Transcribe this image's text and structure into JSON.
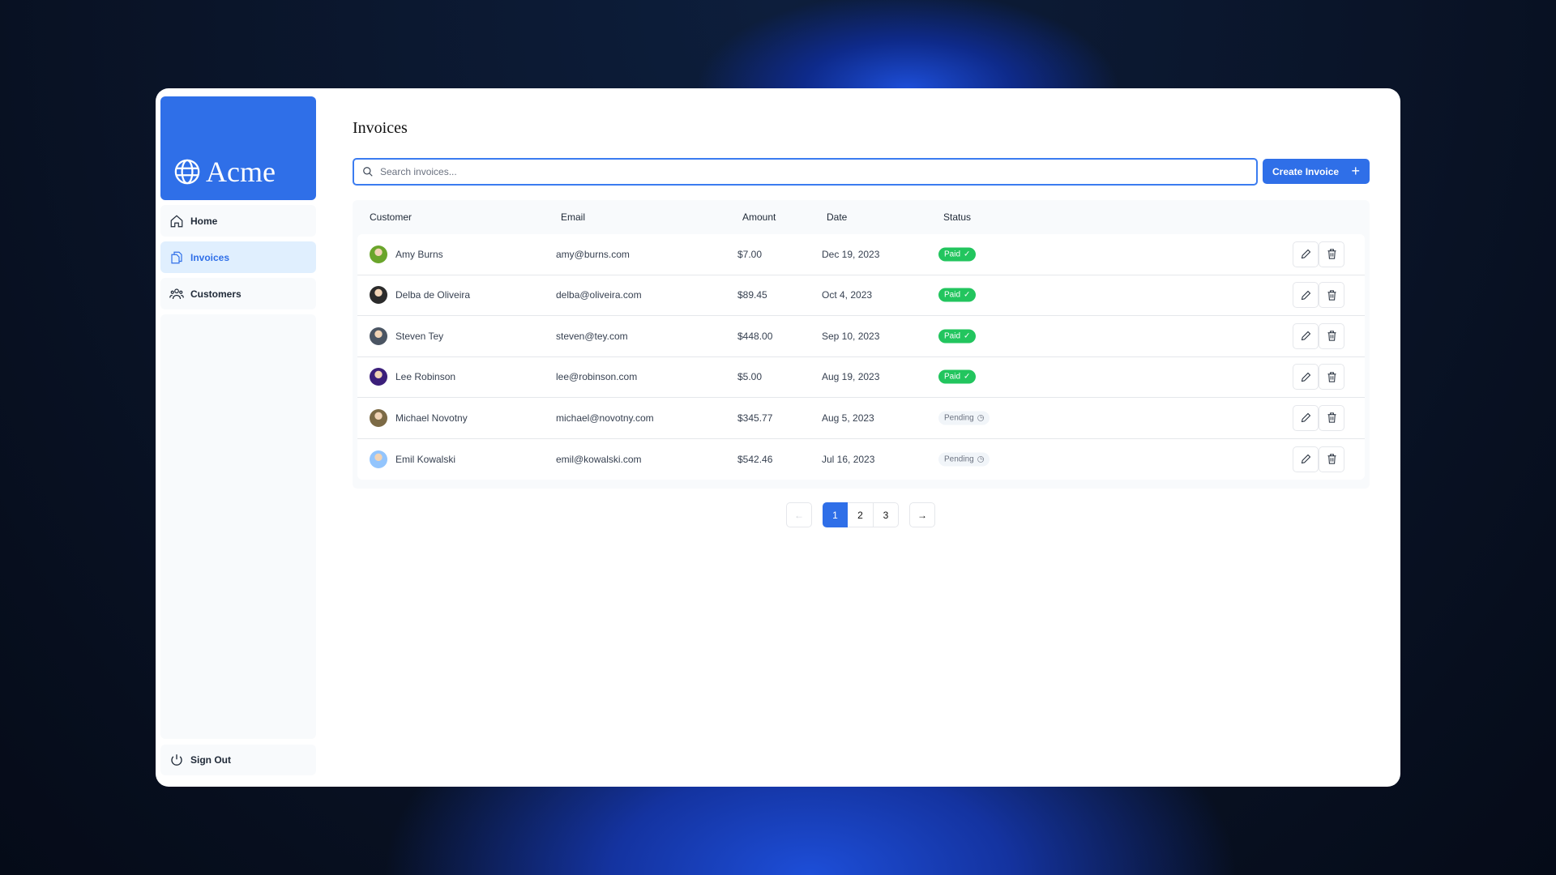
{
  "brand": {
    "name": "Acme"
  },
  "sidebar": {
    "items": [
      {
        "label": "Home",
        "icon": "home-icon"
      },
      {
        "label": "Invoices",
        "icon": "document-icon",
        "active": true
      },
      {
        "label": "Customers",
        "icon": "users-icon"
      }
    ],
    "sign_out": "Sign Out"
  },
  "page": {
    "title": "Invoices"
  },
  "search": {
    "placeholder": "Search invoices...",
    "value": ""
  },
  "toolbar": {
    "create_label": "Create Invoice"
  },
  "table": {
    "headers": [
      "Customer",
      "Email",
      "Amount",
      "Date",
      "Status"
    ],
    "rows": [
      {
        "name": "Amy Burns",
        "email": "amy@burns.com",
        "amount": "$7.00",
        "date": "Dec 19, 2023",
        "status": "Paid",
        "avatar": "#6aa52b"
      },
      {
        "name": "Delba de Oliveira",
        "email": "delba@oliveira.com",
        "amount": "$89.45",
        "date": "Oct 4, 2023",
        "status": "Paid",
        "avatar": "#2b2b2b"
      },
      {
        "name": "Steven Tey",
        "email": "steven@tey.com",
        "amount": "$448.00",
        "date": "Sep 10, 2023",
        "status": "Paid",
        "avatar": "#4b5563"
      },
      {
        "name": "Lee Robinson",
        "email": "lee@robinson.com",
        "amount": "$5.00",
        "date": "Aug 19, 2023",
        "status": "Paid",
        "avatar": "#3b1f7a"
      },
      {
        "name": "Michael Novotny",
        "email": "michael@novotny.com",
        "amount": "$345.77",
        "date": "Aug 5, 2023",
        "status": "Pending",
        "avatar": "#7c6a45"
      },
      {
        "name": "Emil Kowalski",
        "email": "emil@kowalski.com",
        "amount": "$542.46",
        "date": "Jul 16, 2023",
        "status": "Pending",
        "avatar": "#93c5fd"
      }
    ]
  },
  "pagination": {
    "pages": [
      "1",
      "2",
      "3"
    ],
    "current": "1"
  },
  "colors": {
    "accent": "#2f6fe8",
    "paid": "#22c55e"
  }
}
